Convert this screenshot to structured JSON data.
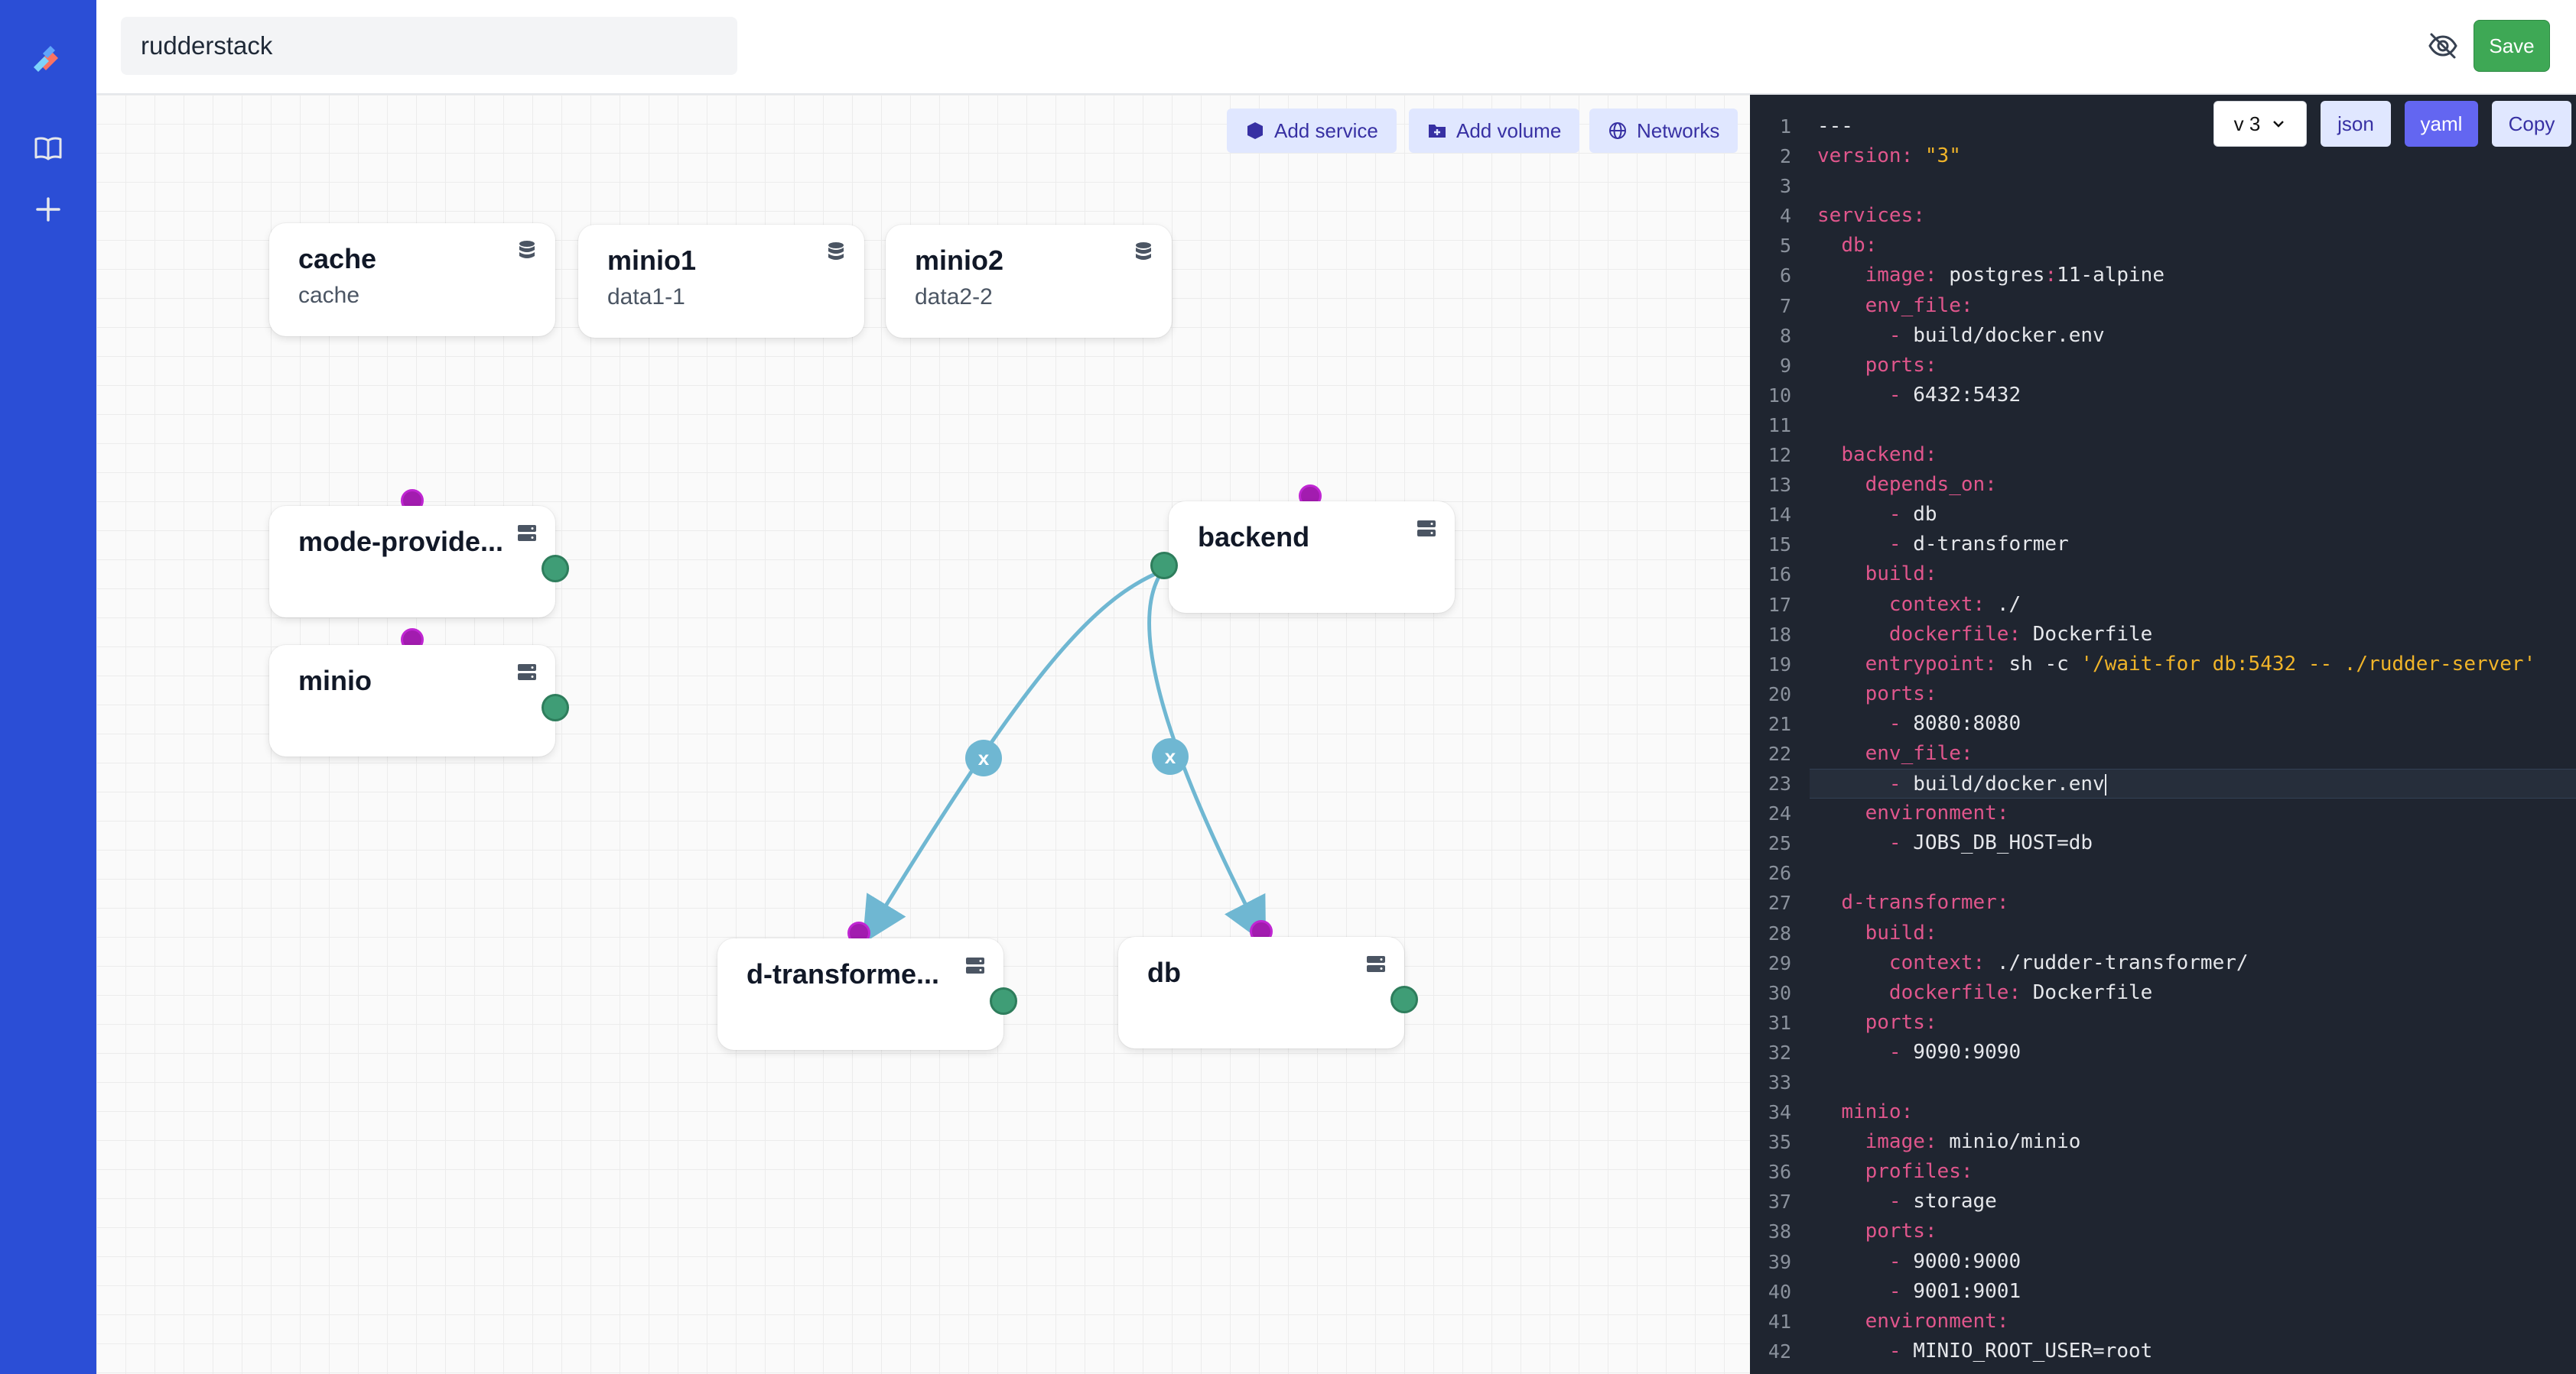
{
  "app": {
    "project_name": "rudderstack",
    "save_label": "Save"
  },
  "toolbar": {
    "add_service_label": "Add service",
    "add_volume_label": "Add volume",
    "networks_label": "Networks"
  },
  "volumes": [
    {
      "name": "cache",
      "sub": "cache"
    },
    {
      "name": "minio1",
      "sub": "data1-1"
    },
    {
      "name": "minio2",
      "sub": "data2-2"
    }
  ],
  "services": {
    "mode_provider": "mode-provide...",
    "minio": "minio",
    "backend": "backend",
    "d_transformer": "d-transforme...",
    "db": "db"
  },
  "edges": [
    {
      "from": "backend",
      "to": "d-transformer",
      "remove_label": "x"
    },
    {
      "from": "backend",
      "to": "db",
      "remove_label": "x"
    }
  ],
  "editor": {
    "version_label": "v 3",
    "json_label": "json",
    "yaml_label": "yaml",
    "copy_label": "Copy",
    "active_format": "yaml",
    "line_numbers": [
      "1",
      "2",
      "3",
      "4",
      "5",
      "6",
      "7",
      "8",
      "9",
      "10",
      "11",
      "12",
      "13",
      "14",
      "15",
      "16",
      "17",
      "18",
      "19",
      "20",
      "21",
      "22",
      "23",
      "24",
      "25",
      "26",
      "27",
      "28",
      "29",
      "30",
      "31",
      "32",
      "33",
      "34",
      "35",
      "36",
      "37",
      "38",
      "39",
      "40",
      "41",
      "42"
    ],
    "lines": [
      {
        "indent": "",
        "key": "",
        "sep": "",
        "val": "---",
        "kind": "plain"
      },
      {
        "indent": "",
        "key": "version",
        "sep": ": ",
        "val": "\"3\"",
        "kind": "string"
      },
      {
        "indent": "",
        "key": "",
        "sep": "",
        "val": "",
        "kind": "plain"
      },
      {
        "indent": "",
        "key": "services",
        "sep": ":",
        "val": "",
        "kind": "plain"
      },
      {
        "indent": "  ",
        "key": "db",
        "sep": ":",
        "val": "",
        "kind": "plain"
      },
      {
        "indent": "    ",
        "key": "image",
        "sep": ": ",
        "val": "postgres:11-alpine",
        "kind": "plain"
      },
      {
        "indent": "    ",
        "key": "env_file",
        "sep": ":",
        "val": "",
        "kind": "plain"
      },
      {
        "indent": "      ",
        "key": "",
        "sep": "- ",
        "val": "build/docker.env",
        "kind": "dash"
      },
      {
        "indent": "    ",
        "key": "ports",
        "sep": ":",
        "val": "",
        "kind": "plain"
      },
      {
        "indent": "      ",
        "key": "",
        "sep": "- ",
        "val": "6432:5432",
        "kind": "dash"
      },
      {
        "indent": "",
        "key": "",
        "sep": "",
        "val": "",
        "kind": "plain"
      },
      {
        "indent": "  ",
        "key": "backend",
        "sep": ":",
        "val": "",
        "kind": "plain"
      },
      {
        "indent": "    ",
        "key": "depends_on",
        "sep": ":",
        "val": "",
        "kind": "plain"
      },
      {
        "indent": "      ",
        "key": "",
        "sep": "- ",
        "val": "db",
        "kind": "dash"
      },
      {
        "indent": "      ",
        "key": "",
        "sep": "- ",
        "val": "d-transformer",
        "kind": "dash"
      },
      {
        "indent": "    ",
        "key": "build",
        "sep": ":",
        "val": "",
        "kind": "plain"
      },
      {
        "indent": "      ",
        "key": "context",
        "sep": ": ",
        "val": "./",
        "kind": "plain"
      },
      {
        "indent": "      ",
        "key": "dockerfile",
        "sep": ": ",
        "val": "Dockerfile",
        "kind": "plain"
      },
      {
        "indent": "    ",
        "key": "entrypoint",
        "sep": ": ",
        "val": "sh -c ",
        "kind": "plain",
        "extra": "'/wait-for db:5432 -- ./rudder-server'"
      },
      {
        "indent": "    ",
        "key": "ports",
        "sep": ":",
        "val": "",
        "kind": "plain"
      },
      {
        "indent": "      ",
        "key": "",
        "sep": "- ",
        "val": "8080:8080",
        "kind": "dash"
      },
      {
        "indent": "    ",
        "key": "env_file",
        "sep": ":",
        "val": "",
        "kind": "plain"
      },
      {
        "indent": "      ",
        "key": "",
        "sep": "- ",
        "val": "build/docker.env",
        "kind": "dash",
        "active": true
      },
      {
        "indent": "    ",
        "key": "environment",
        "sep": ":",
        "val": "",
        "kind": "plain"
      },
      {
        "indent": "      ",
        "key": "",
        "sep": "- ",
        "val": "JOBS_DB_HOST=db",
        "kind": "dash"
      },
      {
        "indent": "",
        "key": "",
        "sep": "",
        "val": "",
        "kind": "plain"
      },
      {
        "indent": "  ",
        "key": "d-transformer",
        "sep": ":",
        "val": "",
        "kind": "plain"
      },
      {
        "indent": "    ",
        "key": "build",
        "sep": ":",
        "val": "",
        "kind": "plain"
      },
      {
        "indent": "      ",
        "key": "context",
        "sep": ": ",
        "val": "./rudder-transformer/",
        "kind": "plain"
      },
      {
        "indent": "      ",
        "key": "dockerfile",
        "sep": ": ",
        "val": "Dockerfile",
        "kind": "plain"
      },
      {
        "indent": "    ",
        "key": "ports",
        "sep": ":",
        "val": "",
        "kind": "plain"
      },
      {
        "indent": "      ",
        "key": "",
        "sep": "- ",
        "val": "9090:9090",
        "kind": "dash"
      },
      {
        "indent": "",
        "key": "",
        "sep": "",
        "val": "",
        "kind": "plain"
      },
      {
        "indent": "  ",
        "key": "minio",
        "sep": ":",
        "val": "",
        "kind": "plain"
      },
      {
        "indent": "    ",
        "key": "image",
        "sep": ": ",
        "val": "minio/minio",
        "kind": "plain"
      },
      {
        "indent": "    ",
        "key": "profiles",
        "sep": ":",
        "val": "",
        "kind": "plain"
      },
      {
        "indent": "      ",
        "key": "",
        "sep": "- ",
        "val": "storage",
        "kind": "dash"
      },
      {
        "indent": "    ",
        "key": "ports",
        "sep": ":",
        "val": "",
        "kind": "plain"
      },
      {
        "indent": "      ",
        "key": "",
        "sep": "- ",
        "val": "9000:9000",
        "kind": "dash"
      },
      {
        "indent": "      ",
        "key": "",
        "sep": "- ",
        "val": "9001:9001",
        "kind": "dash"
      },
      {
        "indent": "    ",
        "key": "environment",
        "sep": ":",
        "val": "",
        "kind": "plain"
      },
      {
        "indent": "      ",
        "key": "",
        "sep": "- ",
        "val": "MINIO_ROOT_USER=root",
        "kind": "dash"
      }
    ]
  },
  "colors": {
    "rail": "#2b4ed6",
    "save": "#3ea855",
    "edge": "#6fb7d2",
    "port_in": "#a21caf",
    "port_out": "#3f9d76",
    "yaml_key": "#e0568c",
    "yaml_string": "#f0b429",
    "editor_bg": "#1f2530"
  }
}
